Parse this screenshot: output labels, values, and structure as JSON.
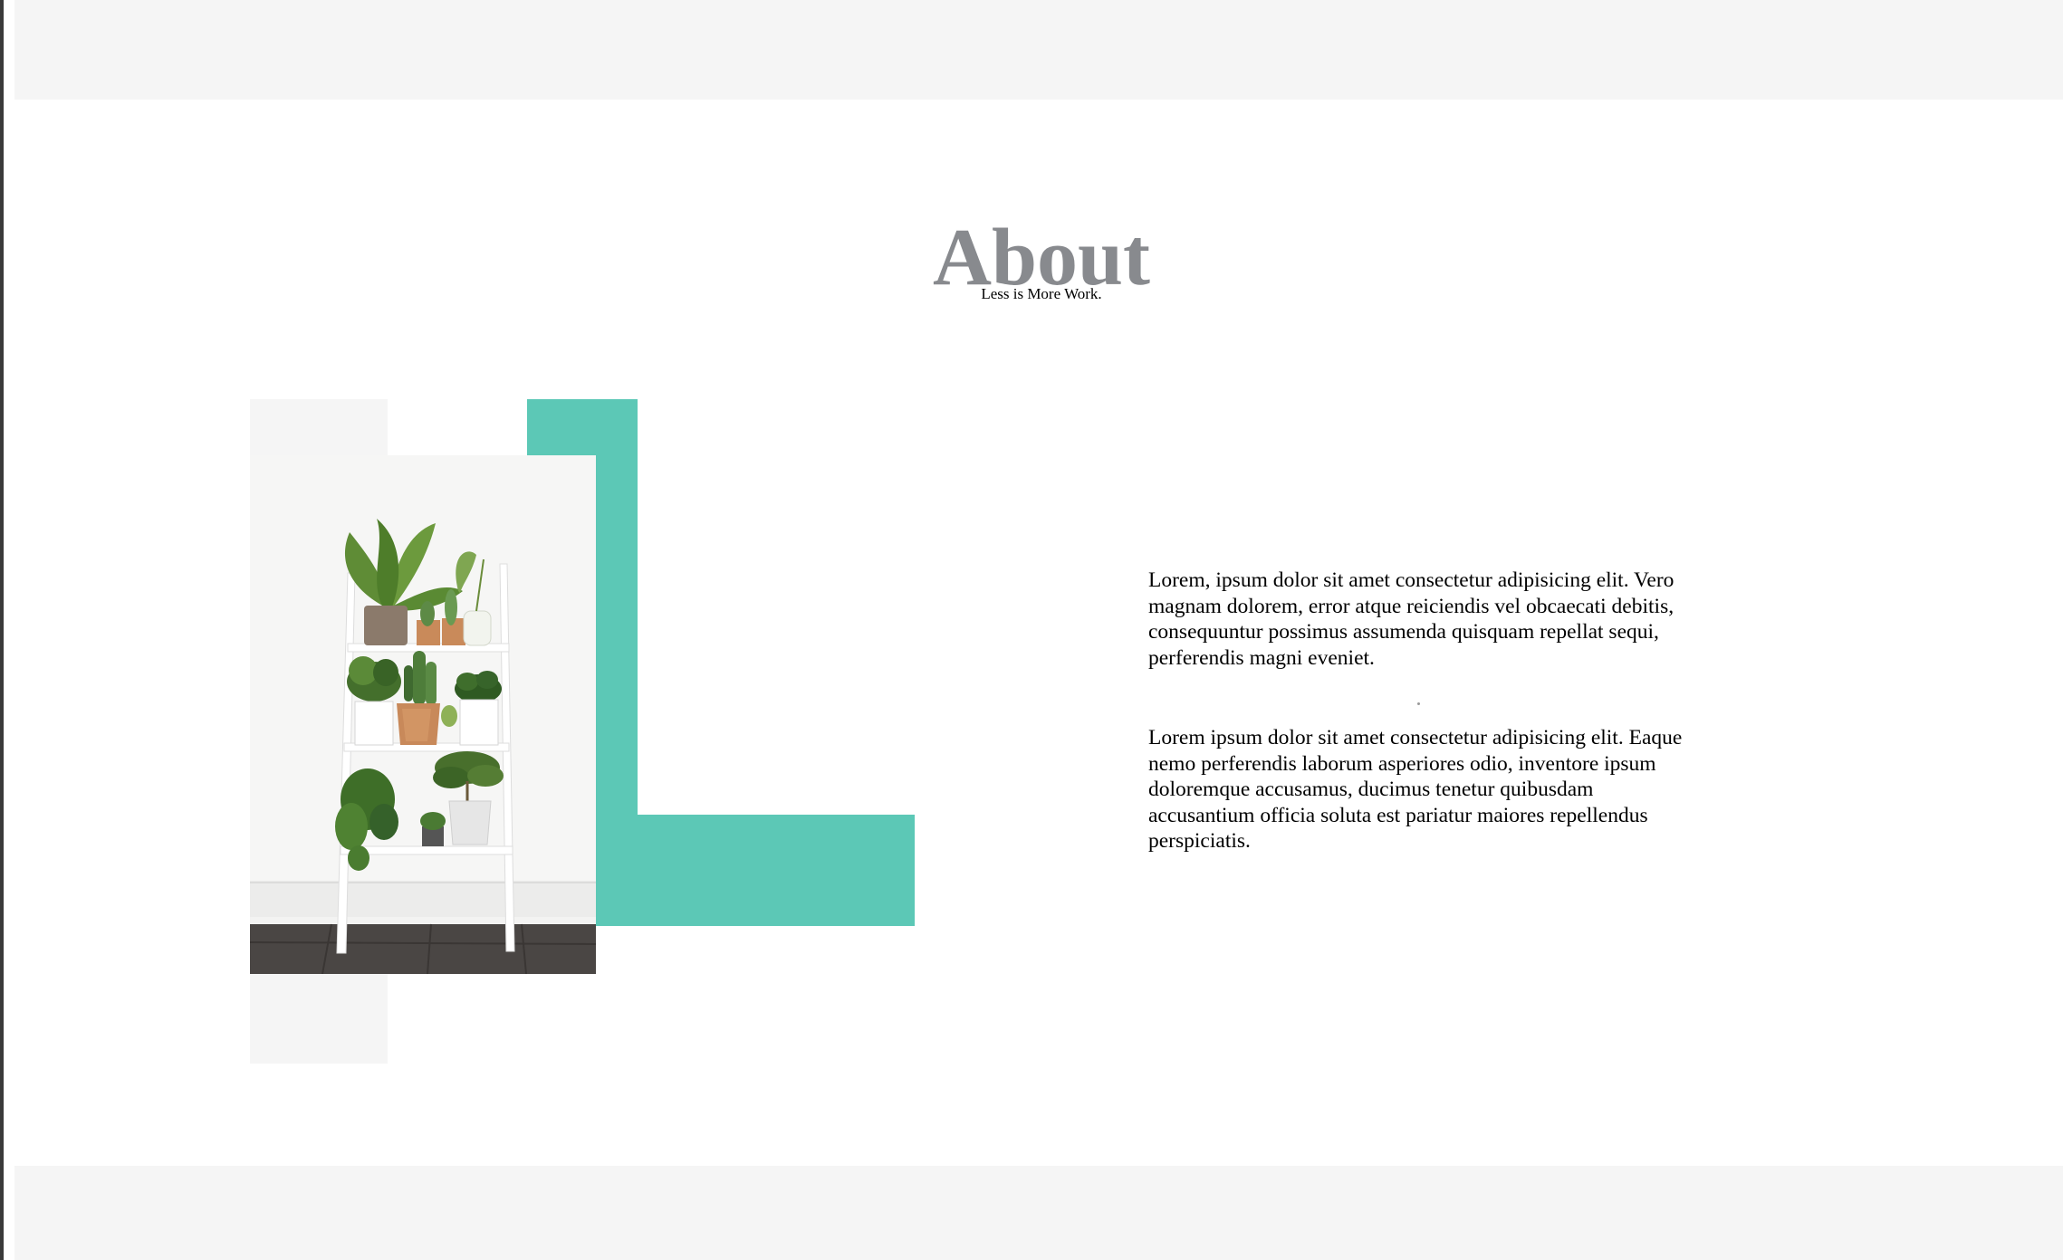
{
  "about": {
    "title": "About",
    "subtitle": "Less is More Work."
  },
  "content": {
    "paragraphs": [
      "Lorem, ipsum dolor sit amet consectetur adipisicing elit. Vero magnam dolorem, error atque reiciendis vel obcaecati debitis, consequuntur possimus assumenda quisquam repellat sequi, perferendis magni eveniet.",
      "Lorem ipsum dolor sit amet consectetur adipisicing elit. Eaque nemo perferendis laborum asperiores odio, inventore ipsum doloremque accusamus, ducimus tenetur quibusdam accusantium officia soluta est pariatur maiores repellendus perspiciatis."
    ]
  },
  "image": {
    "subject": "white ladder shelf with potted plants"
  },
  "colors": {
    "accent": "#5cc8b6",
    "title": "#888a8e",
    "band": "#f5f5f5",
    "floor": "#4a4644"
  }
}
